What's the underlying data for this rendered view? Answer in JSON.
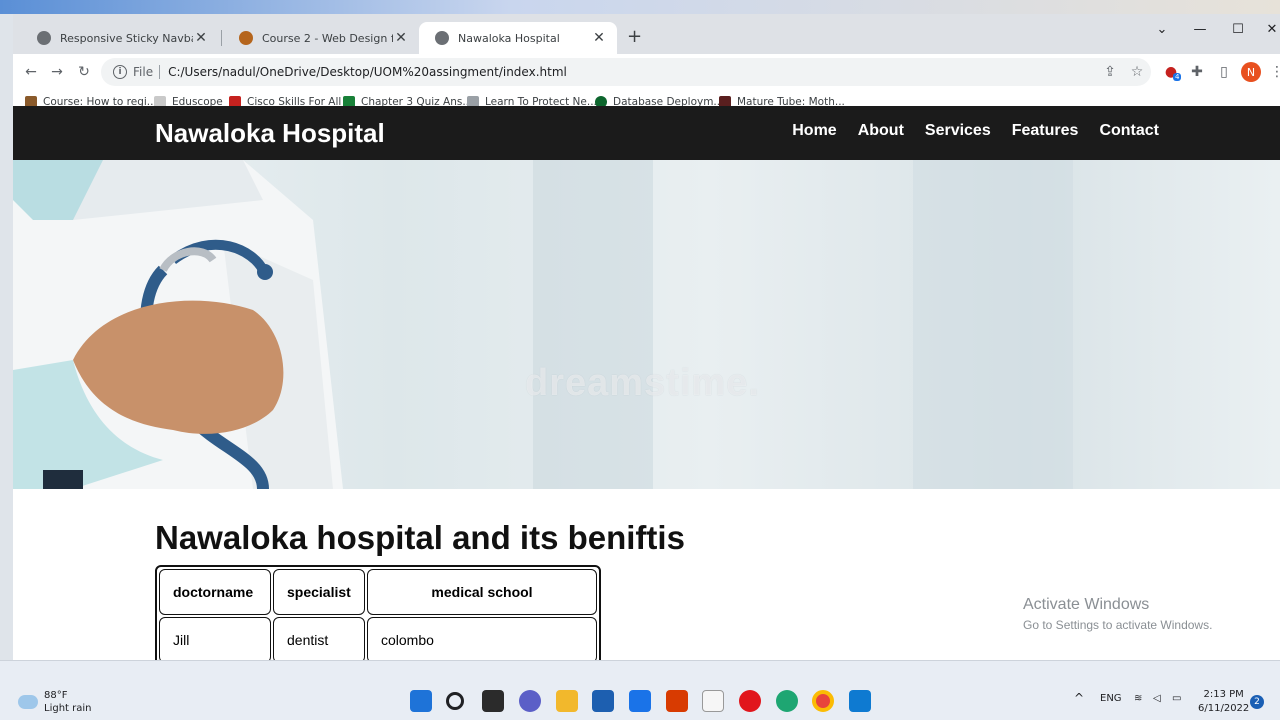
{
  "browser": {
    "tabs": [
      {
        "title": "Responsive Sticky Navbar | Codin",
        "active": false
      },
      {
        "title": "Course 2 - Web Design for Begin",
        "active": false
      },
      {
        "title": "Nawaloka Hospital",
        "active": true
      }
    ],
    "address": {
      "scheme": "File",
      "url": "C:/Users/nadul/OneDrive/Desktop/UOM%20assingment/index.html"
    },
    "profile_initial": "N",
    "extension_badge": "4",
    "bookmarks": [
      "Course: How to regi...",
      "Eduscope",
      "Cisco Skills For All",
      "Chapter 3 Quiz Ans...",
      "Learn To Protect Ne...",
      "Database Deploym...",
      "Mature Tube: Moth..."
    ]
  },
  "page": {
    "brand": "Nawaloka Hospital",
    "nav": [
      "Home",
      "About",
      "Services",
      "Features",
      "Contact"
    ],
    "hero_watermark": "dreamstime.",
    "heading": "Nawaloka hospital and its beniftis",
    "table": {
      "headers": [
        "doctorname",
        "specialist",
        "medical school"
      ],
      "rows": [
        [
          "Jill",
          "dentist",
          "colombo"
        ]
      ]
    }
  },
  "overlay": {
    "activate_title": "Activate Windows",
    "activate_sub": "Go to Settings to activate Windows."
  },
  "taskbar": {
    "weather_temp": "88°F",
    "weather_desc": "Light rain",
    "language": "ENG",
    "time": "2:13 PM",
    "date": "6/11/2022",
    "notifications": "2"
  },
  "colors": {
    "navbar_bg": "#1b1b1b",
    "accent": "#1a73e8"
  }
}
